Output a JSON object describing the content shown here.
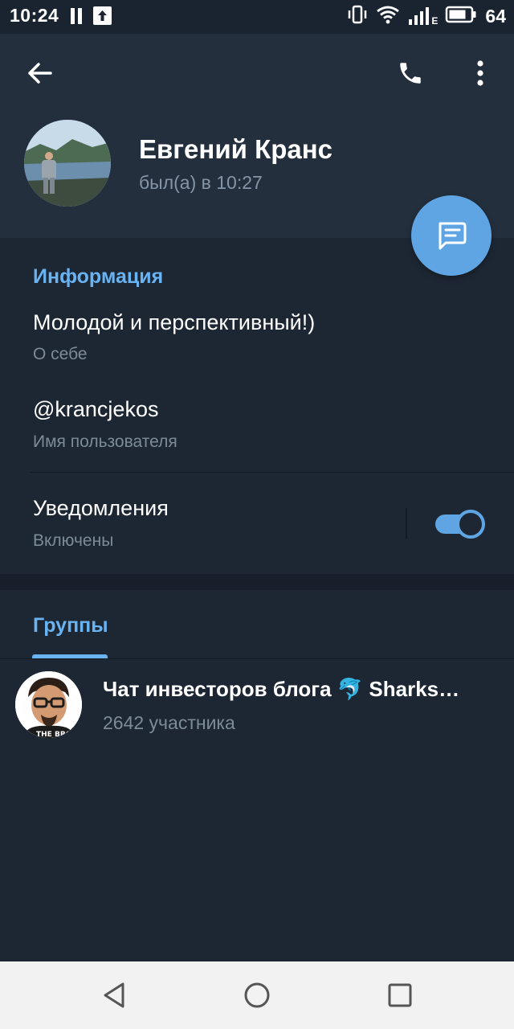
{
  "status_bar": {
    "time": "10:24",
    "network": "E",
    "battery": "64"
  },
  "header": {
    "name": "Евгений Кранс",
    "last_seen": "был(а) в 10:27"
  },
  "info": {
    "section_title": "Информация",
    "bio": "Молодой и перспективный!)",
    "bio_label": "О себе",
    "username": "@krancjekos",
    "username_label": "Имя пользователя",
    "notifications": "Уведомления",
    "notifications_state": "Включены",
    "notifications_enabled": true
  },
  "groups": {
    "tab_label": "Группы",
    "items": [
      {
        "name": "Чат инвесторов блога 🐬 Sharks…",
        "members": "2642 участника"
      }
    ]
  },
  "colors": {
    "accent": "#6ab3f3",
    "fab": "#5fa5e3",
    "header_bg": "#242f3d",
    "body_bg": "#1d2733"
  },
  "icons": [
    "back-arrow-icon",
    "phone-icon",
    "more-vert-icon",
    "message-icon",
    "nav-back-icon",
    "nav-home-icon",
    "nav-recents-icon"
  ]
}
